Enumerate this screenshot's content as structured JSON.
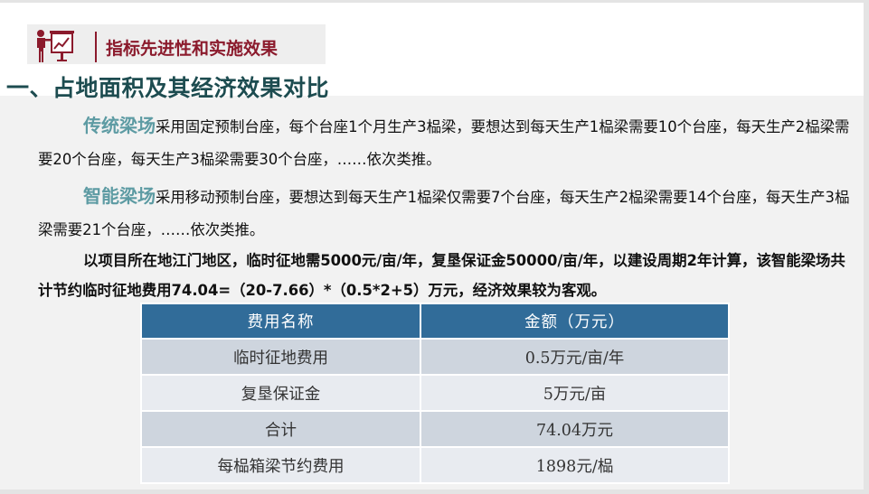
{
  "header": {
    "title": "指标先进性和实施效果",
    "icon": "presentation-chart-icon",
    "accent_color": "#8b1a2c"
  },
  "section_title": "一、占地面积及其经济效果对比",
  "paragraphs": {
    "traditional": {
      "highlight": "传统梁场",
      "text": "采用固定预制台座，每个台座1个月生产3榀梁，要想达到每天生产1榀梁需要10个台座，每天生产2榀梁需要20个台座，每天生产3榀梁需要30个台座，……依次类推。"
    },
    "smart": {
      "highlight": "智能梁场",
      "text": "采用移动预制台座，要想达到每天生产1榀梁仅需要7个台座，每天生产2榀梁需要14个台座，每天生产3榀梁需要21个台座，……依次类推。"
    },
    "summary": "以项目所在地江门地区，临时征地需5000元/亩/年，复垦保证金50000/亩/年，以建设周期2年计算，该智能梁场共计节约临时征地费用74.04=（20-7.66）*（0.5*2+5）万元，经济效果较为客观。"
  },
  "table": {
    "headers": [
      "费用名称",
      "金额（万元）"
    ],
    "rows": [
      [
        "临时征地费用",
        "0.5万元/亩/年"
      ],
      [
        "复垦保证金",
        "5万元/亩"
      ],
      [
        "合计",
        "74.04万元"
      ],
      [
        "每榀箱梁节约费用",
        "1898元/榀"
      ]
    ],
    "header_color": "#316c99"
  }
}
